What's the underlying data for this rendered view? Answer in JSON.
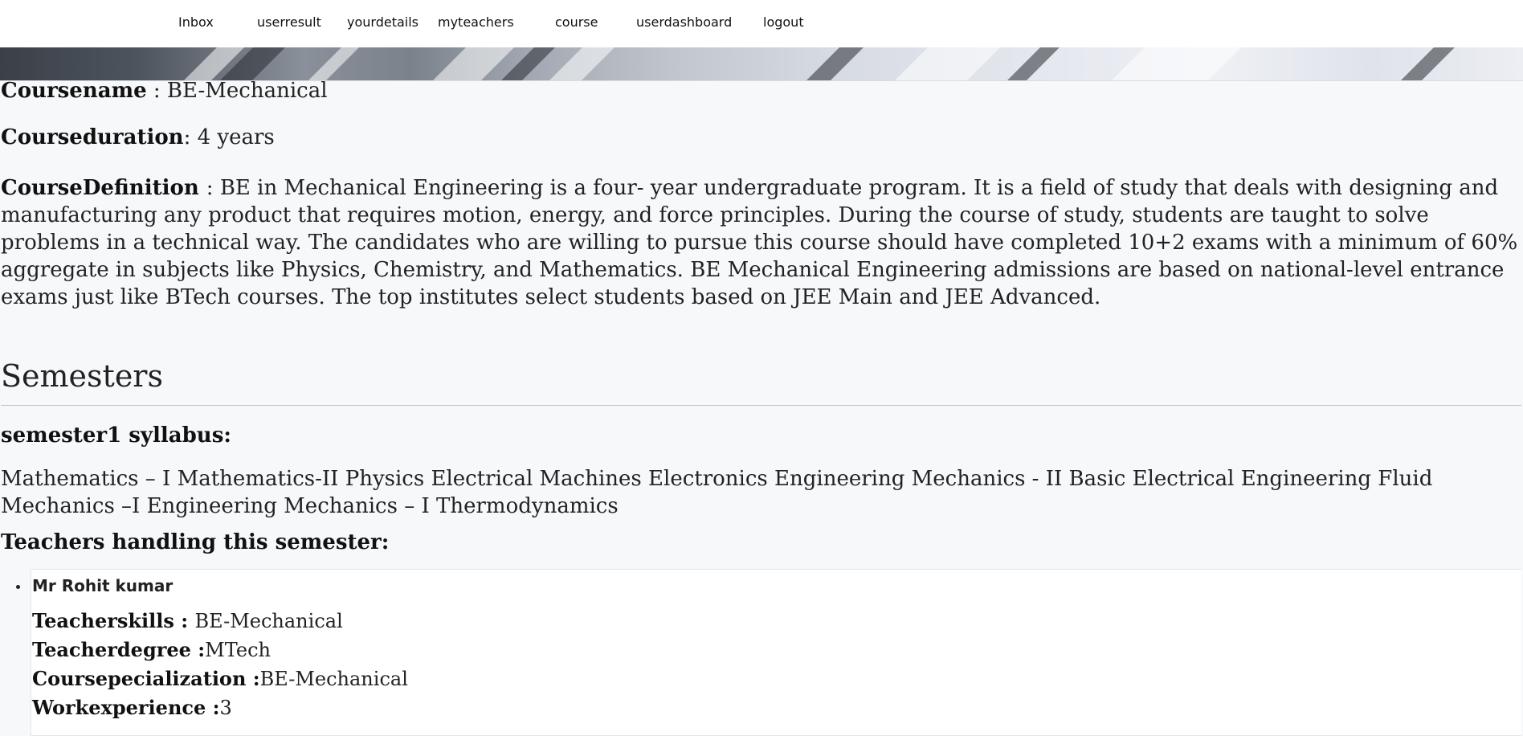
{
  "nav": {
    "items": [
      {
        "label": "Inbox"
      },
      {
        "label": "userresult"
      },
      {
        "label": "yourdetails"
      },
      {
        "label": "myteachers"
      },
      {
        "label": "course"
      },
      {
        "label": "userdashboard"
      },
      {
        "label": "logout"
      }
    ]
  },
  "course": {
    "name_label": "Coursename",
    "name_sep": " : ",
    "name_value": "BE-Mechanical",
    "duration_label": "Courseduration",
    "duration_sep": ": ",
    "duration_value": "4 years",
    "definition_label": "CourseDefinition ",
    "definition_sep": ": ",
    "definition_value": "BE in Mechanical Engineering is a four- year undergraduate program. It is a field of study that deals with designing and manufacturing any product that requires motion, energy, and force principles. During the course of study, students are taught to solve problems in a technical way. The candidates who are willing to pursue this course should have completed 10+2 exams with a minimum of 60% aggregate in subjects like Physics, Chemistry, and Mathematics. BE Mechanical Engineering admissions are based on national-level entrance exams just like BTech courses. The top institutes select students based on JEE Main and JEE Advanced."
  },
  "semesters": {
    "title": "Semesters",
    "items": [
      {
        "heading": "semester1 syllabus:",
        "syllabus": " Mathematics – I Mathematics-II Physics Electrical Machines Electronics Engineering Mechanics - II Basic Electrical Engineering Fluid Mechanics –I Engineering Mechanics – I Thermodynamics",
        "teachers_heading": "Teachers handling this semester:",
        "teachers": [
          {
            "name": "Mr Rohit kumar",
            "skills_label": "Teacherskills : ",
            "skills_value": "BE-Mechanical",
            "degree_label": "Teacherdegree :",
            "degree_value": "MTech",
            "specialization_label": "Coursepecialization :",
            "specialization_value": "BE-Mechanical",
            "experience_label": "Workexperience :",
            "experience_value": "3"
          }
        ]
      }
    ]
  }
}
